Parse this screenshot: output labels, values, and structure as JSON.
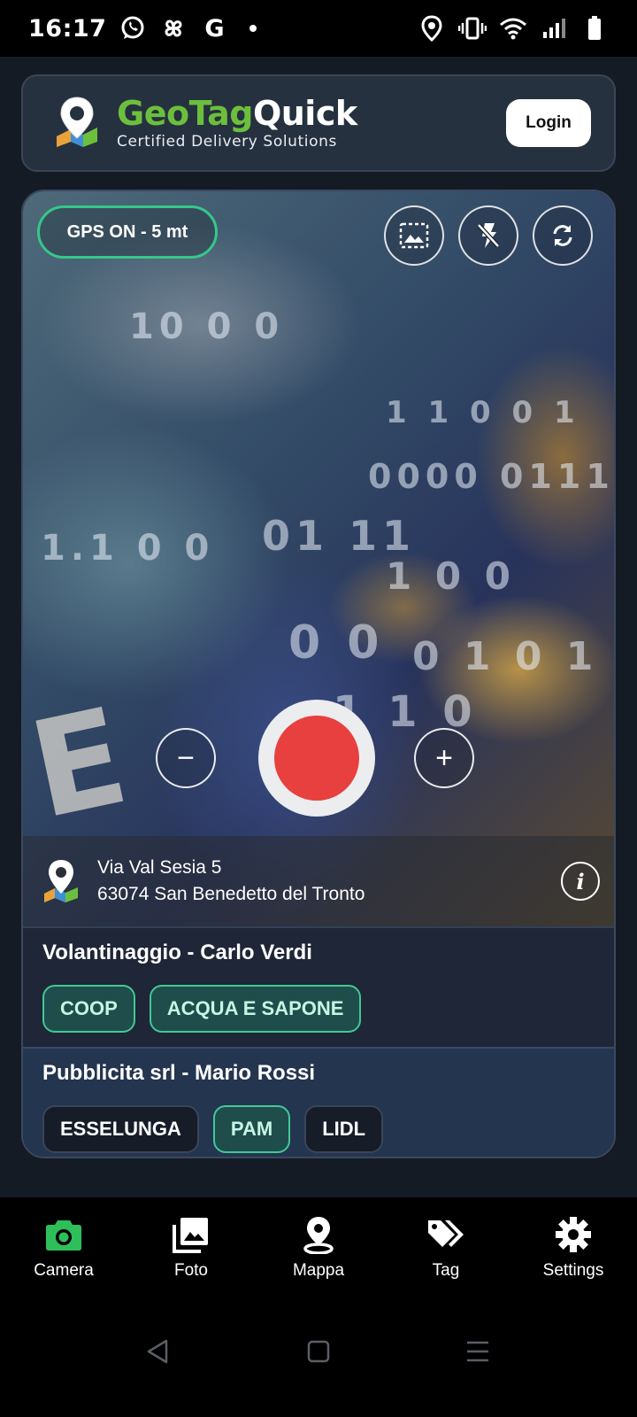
{
  "status_bar": {
    "time": "16:17",
    "left_icons": [
      "whatsapp-icon",
      "pinwheel-icon",
      "google-icon",
      "notification-dot"
    ],
    "google_letter": "G",
    "right_icons": [
      "location-icon",
      "vibrate-icon",
      "wifi-icon",
      "signal-icon",
      "battery-icon"
    ]
  },
  "header": {
    "brand_part1": "GeoTag",
    "brand_part2": "Quick",
    "tagline": "Certified Delivery Solutions",
    "login_label": "Login",
    "colors": {
      "brand_green": "#6cbf3c",
      "card_bg": "#26313f"
    }
  },
  "camera": {
    "gps_status": "GPS ON - 5 mt",
    "top_controls": [
      "screen-frame-icon",
      "flash-off-icon",
      "switch-camera-icon"
    ],
    "zoom_out_label": "−",
    "zoom_in_label": "+",
    "shutter_color": "#e8403e",
    "address": {
      "line1": "Via Val Sesia 5",
      "line2": "63074 San Benedetto del Tronto"
    },
    "info_label": "i"
  },
  "clients": [
    {
      "name": "Volantinaggio - Carlo Verdi",
      "tags": [
        {
          "label": "COOP",
          "selected": true
        },
        {
          "label": "ACQUA E SAPONE",
          "selected": true
        }
      ]
    },
    {
      "name": "Pubblicita srl - Mario Rossi",
      "tags": [
        {
          "label": "ESSELUNGA",
          "selected": false
        },
        {
          "label": "PAM",
          "selected": true
        },
        {
          "label": "LIDL",
          "selected": false
        }
      ]
    }
  ],
  "bottom_nav": {
    "items": [
      {
        "label": "Camera",
        "icon": "camera-icon",
        "active": true
      },
      {
        "label": "Foto",
        "icon": "gallery-icon",
        "active": false
      },
      {
        "label": "Mappa",
        "icon": "map-pin-icon",
        "active": false
      },
      {
        "label": "Tag",
        "icon": "tag-icon",
        "active": false
      },
      {
        "label": "Settings",
        "icon": "gear-icon",
        "active": false
      }
    ],
    "active_color": "#2fbf5a"
  },
  "system_nav": [
    "back-icon",
    "home-icon",
    "recents-icon"
  ]
}
